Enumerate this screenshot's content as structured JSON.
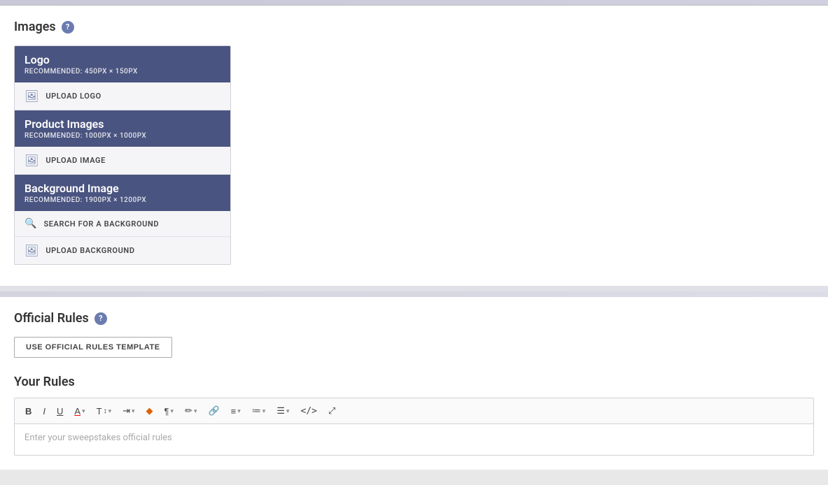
{
  "top_bar": {},
  "images_section": {
    "title": "Images",
    "help_label": "?",
    "logo_block": {
      "name": "Logo",
      "recommendation": "Recommended: 450px × 150px",
      "upload_label": "UPLOAD LOGO"
    },
    "product_images_block": {
      "name": "Product Images",
      "recommendation": "Recommended: 1000px × 1000px",
      "upload_label": "UPLOAD IMAGE"
    },
    "background_block": {
      "name": "Background Image",
      "recommendation": "Recommended: 1900px × 1200px",
      "search_label": "SEARCH FOR A BACKGROUND",
      "upload_label": "UPLOAD BACKGROUND"
    }
  },
  "official_rules_section": {
    "title": "Official Rules",
    "help_label": "?",
    "template_btn_label": "USE OFFICIAL RULES TEMPLATE",
    "your_rules_title": "Your Rules",
    "editor": {
      "toolbar": {
        "bold": "B",
        "italic": "I",
        "underline": "U",
        "font_color": "A",
        "text_size": "T↕",
        "indent": "⇥",
        "highlight": "◈",
        "paragraph": "¶",
        "format": "✏",
        "link": "⊙",
        "align": "≡",
        "list_ordered": "≔",
        "list_unordered": "≡",
        "code": "</>",
        "expand": "⤢"
      },
      "placeholder": "Enter your sweepstakes official rules"
    }
  }
}
